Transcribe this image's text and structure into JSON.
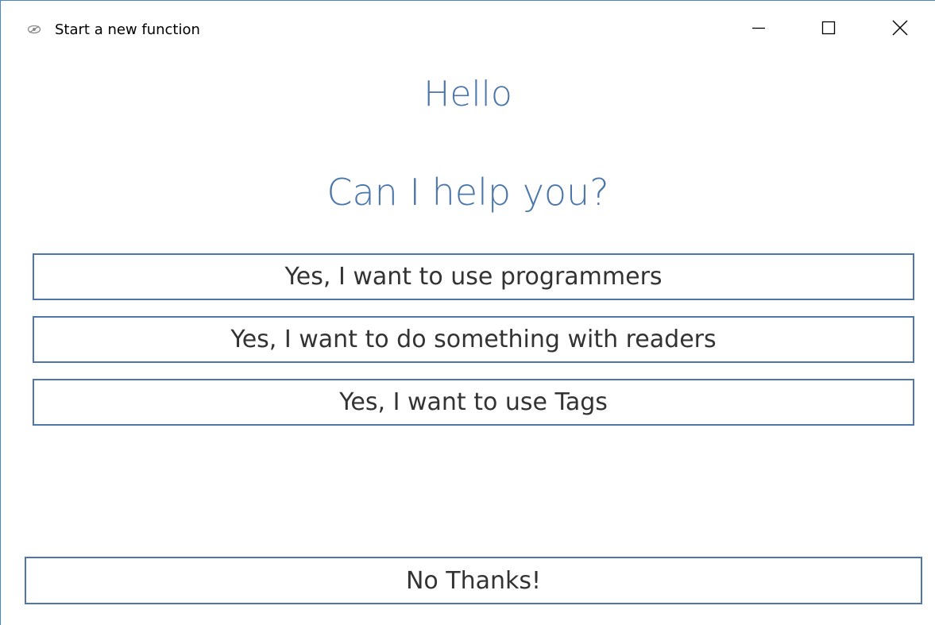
{
  "window": {
    "title": "Start a new function",
    "app_icon": "eye-icon",
    "controls": {
      "minimize": "minimize-icon",
      "maximize": "maximize-icon",
      "close": "close-icon"
    }
  },
  "content": {
    "greeting": "Hello",
    "question": "Can I help you?",
    "options": [
      {
        "label": "Yes, I want to use programmers"
      },
      {
        "label": "Yes, I want to do something with readers"
      },
      {
        "label": "Yes, I want to use Tags"
      }
    ],
    "decline_label": "No Thanks!"
  },
  "colors": {
    "accent": "#4a76ab",
    "border": "#4f76a8",
    "button_text": "#333333",
    "window_border": "#4a86c8",
    "background": "#ffffff"
  }
}
